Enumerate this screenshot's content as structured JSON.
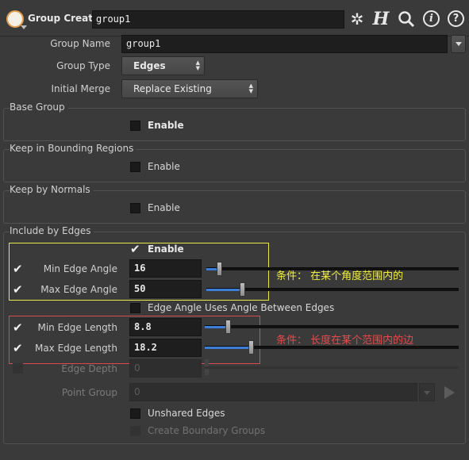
{
  "header": {
    "node_type": "Group Create",
    "node_name": "group1"
  },
  "params": {
    "group_name": {
      "label": "Group Name",
      "value": "group1"
    },
    "group_type": {
      "label": "Group Type",
      "value": "Edges"
    },
    "initial_merge": {
      "label": "Initial Merge",
      "value": "Replace Existing"
    }
  },
  "sections": {
    "base_group": {
      "title": "Base Group",
      "enable": "Enable"
    },
    "bounding": {
      "title": "Keep in Bounding Regions",
      "enable": "Enable"
    },
    "normals": {
      "title": "Keep by Normals",
      "enable": "Enable"
    },
    "edges": {
      "title": "Include by Edges",
      "enable": "Enable",
      "min_angle": {
        "label": "Min Edge Angle",
        "value": "16",
        "fill": 0.05
      },
      "max_angle": {
        "label": "Max Edge Angle",
        "value": "50",
        "fill": 0.14
      },
      "angle_between": "Edge Angle Uses Angle Between Edges",
      "min_length": {
        "label": "Min Edge Length",
        "value": "8.8",
        "fill": 0.09
      },
      "max_length": {
        "label": "Max Edge Length",
        "value": "18.2",
        "fill": 0.18
      },
      "edge_depth": {
        "label": "Edge Depth",
        "value": "0"
      },
      "point_group": {
        "label": "Point Group",
        "value": "0"
      },
      "unshared": "Unshared Edges",
      "boundary": "Create Boundary Groups"
    }
  },
  "annotations": {
    "angle_note": "条件： 在某个角度范围内的",
    "length_note": "条件： 长度在某个范围内的边"
  },
  "colors": {
    "slider_fill": "#3d7dd6",
    "yellow_box": "#e8e84a",
    "red_box": "#d94c4c"
  }
}
